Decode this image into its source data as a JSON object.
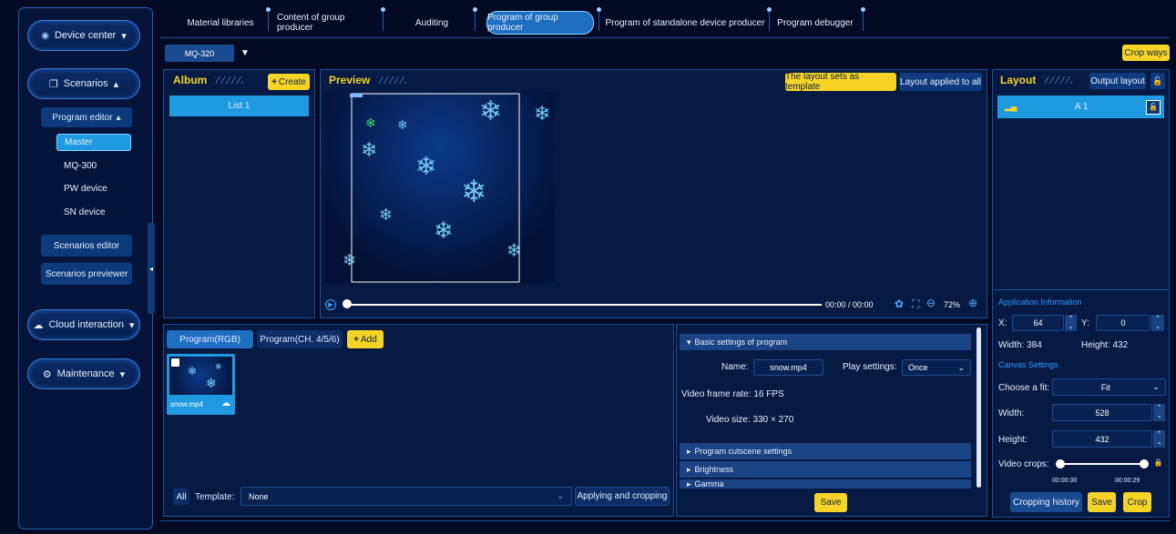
{
  "sidebar": {
    "device_center": "Device center",
    "scenarios": "Scenarios",
    "program_editor": "Program editor",
    "items": [
      "Master",
      "MQ-300",
      "PW device",
      "SN device"
    ],
    "scenarios_editor": "Scenarios editor",
    "scenarios_previewer": "Scenarios previewer",
    "cloud": "Cloud interaction",
    "maintenance": "Maintenance"
  },
  "tabs": [
    "Material libraries",
    "Content of group producer",
    "Auditing",
    "Program of group producer",
    "Program of standalone device producer",
    "Program debugger"
  ],
  "device_select": "MQ-320",
  "crop_ways": "Crop ways",
  "album": {
    "title": "Album",
    "create": "Create",
    "list": "List 1"
  },
  "preview": {
    "title": "Preview",
    "template_btn": "The layout sets as template",
    "applied_btn": "Layout applied to all",
    "time": "00:00 / 00:00",
    "zoom": "72%"
  },
  "program": {
    "tab1": "Program(RGB)",
    "tab2": "Program(CH. 4/5/6)",
    "add": "Add",
    "thumb_name": "snow.mp4",
    "all": "All",
    "template_label": "Template:",
    "template_value": "None",
    "apply_btn": "Applying and cropping"
  },
  "settings": {
    "basic": "Basic settings of program",
    "name_label": "Name:",
    "name_value": "snow.mp4",
    "play_label": "Play settings:",
    "play_value": "Once",
    "fps_label": "Video frame rate:",
    "fps_value": "16 FPS",
    "size_label": "Video size:",
    "size_value": "330 × 270",
    "cutscene": "Program cutscene settings",
    "brightness": "Brightness",
    "gamma": "Gamma",
    "save": "Save"
  },
  "layout": {
    "title": "Layout",
    "output": "Output layout",
    "item": "A 1",
    "app_info": "Application Information",
    "x_label": "X:",
    "x_value": "64",
    "y_label": "Y:",
    "y_value": "0",
    "width_text": "Width: 384",
    "height_text": "Height: 432",
    "canvas": "Canvas Settings",
    "fit_label": "Choose a fit:",
    "fit_value": "Fit",
    "w_label": "Width:",
    "w_value": "528",
    "h_label": "Height:",
    "h_value": "432",
    "crops_label": "Video crops:",
    "crop_start": "00:00:00",
    "crop_end": "00:00:29",
    "history": "Cropping history",
    "save": "Save",
    "crop": "Crop"
  },
  "colors": {
    "accent": "#f5d427",
    "panel": "#071a44",
    "active": "#1f9ae0"
  }
}
